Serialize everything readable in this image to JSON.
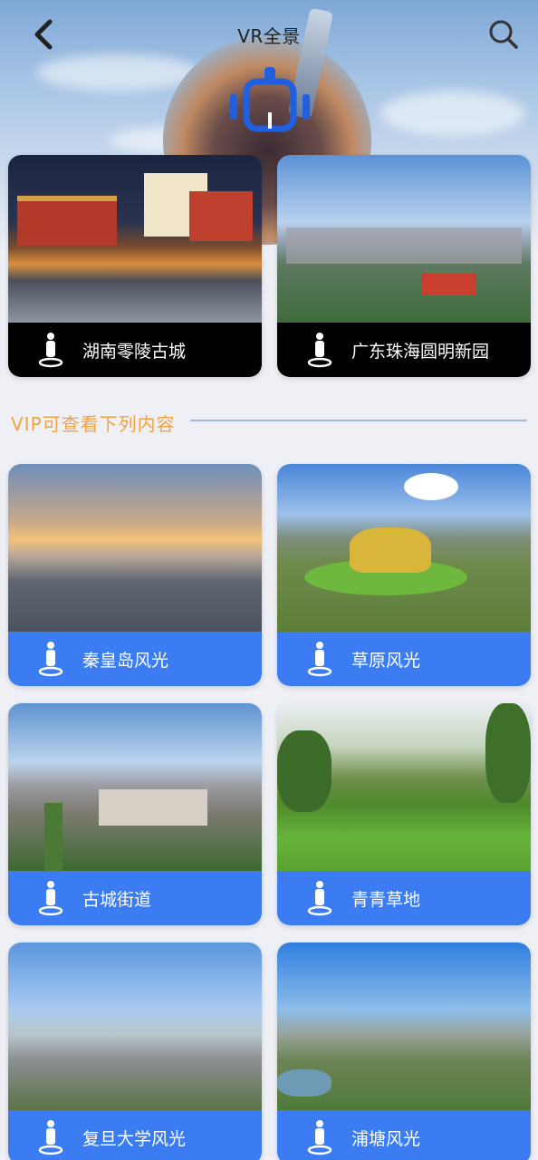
{
  "header": {
    "title": "VR全景",
    "back_icon": "chevron-left-icon",
    "search_icon": "search-icon",
    "logo_icon": "vr-headset-icon"
  },
  "featured": [
    {
      "label": "湖南零陵古城",
      "icon": "person-pin-icon"
    },
    {
      "label": "广东珠海圆明新园",
      "icon": "person-pin-icon"
    }
  ],
  "vip_section": {
    "title": "VIP可查看下列内容"
  },
  "vip_items": [
    {
      "label": "秦皇岛风光",
      "icon": "person-pin-icon"
    },
    {
      "label": "草原风光",
      "icon": "person-pin-icon"
    },
    {
      "label": "古城街道",
      "icon": "person-pin-icon"
    },
    {
      "label": "青青草地",
      "icon": "person-pin-icon"
    },
    {
      "label": "复旦大学风光",
      "icon": "person-pin-icon"
    },
    {
      "label": "浦塘风光",
      "icon": "person-pin-icon"
    }
  ],
  "colors": {
    "accent_blue": "#3b7cf2",
    "vip_orange": "#f0a340",
    "dark_bar": "#000000"
  }
}
